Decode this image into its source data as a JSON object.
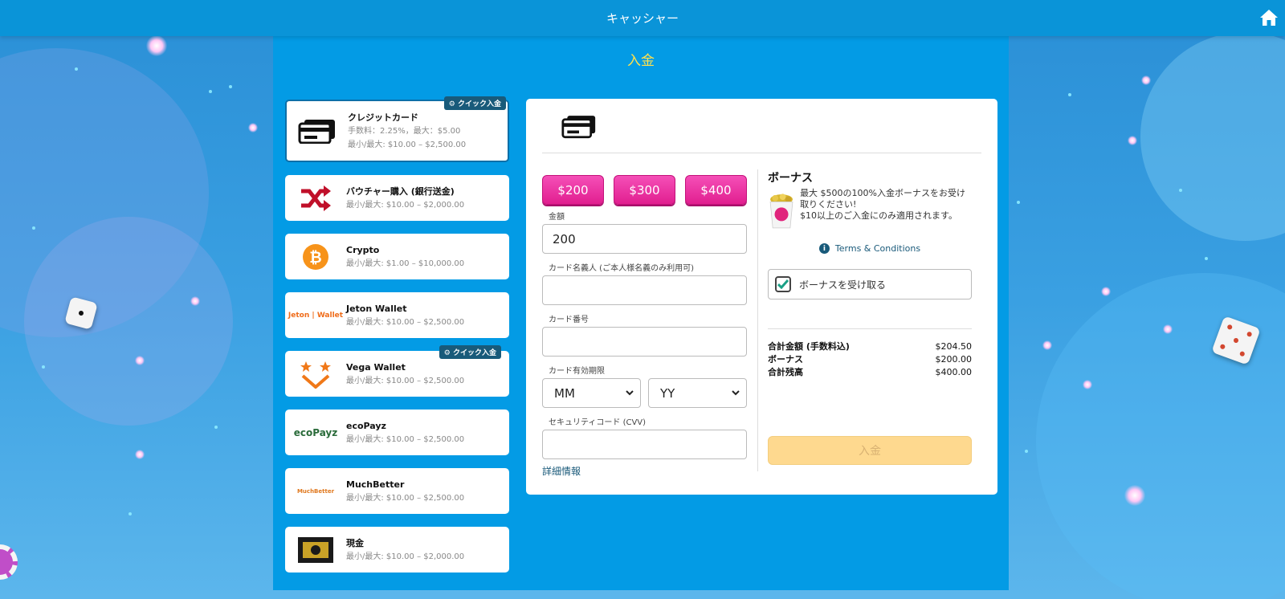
{
  "header": {
    "title": "キャッシャー"
  },
  "section_title": "入金",
  "colors": {
    "topbar": "#0a94d8",
    "panel": "#039be5",
    "section_title": "#ffe14d",
    "amount_button": "#e11f8f",
    "submit": "#fed98f",
    "badge": "#185a7a"
  },
  "quick_badge_label": "クイック入金",
  "methods": [
    {
      "icon": "credit-card-icon",
      "name": "クレジットカード",
      "line1": "手数料：2.25%，最大：$5.00",
      "line2": "最小/最大: $10.00 – $2,500.00",
      "quick": true
    },
    {
      "icon": "shuffle-icon",
      "name": "バウチャー購入 (銀行送金)",
      "line1": "最小/最大: $10.00 – $2,000.00",
      "quick": false
    },
    {
      "icon": "bitcoin-icon",
      "name": "Crypto",
      "line1": "最小/最大: $1.00 – $10,000.00",
      "quick": false
    },
    {
      "icon": "jeton-wallet-logo",
      "logo_text": "Jeton | Wallet",
      "name": "Jeton Wallet",
      "line1": "最小/最大: $10.00 – $2,500.00",
      "quick": false
    },
    {
      "icon": "vega-wallet-logo",
      "name": "Vega Wallet",
      "line1": "最小/最大: $10.00 – $2,500.00",
      "quick": true
    },
    {
      "icon": "ecopayz-logo",
      "logo_text": "ecoPayz",
      "name": "ecoPayz",
      "line1": "最小/最大: $10.00 – $2,500.00",
      "quick": false
    },
    {
      "icon": "muchbetter-logo",
      "logo_text": "MuchBetter",
      "name": "MuchBetter",
      "line1": "最小/最大: $10.00 – $2,500.00",
      "quick": false
    },
    {
      "icon": "cash-logo",
      "name": "現金",
      "line1": "最小/最大: $10.00 – $2,000.00",
      "quick": false
    }
  ],
  "form": {
    "amount_buttons": [
      "$200",
      "$300",
      "$400"
    ],
    "amount_label": "金額",
    "amount_value": "200",
    "cardholder_label": "カード名義人 (ご本人様名義のみ利用可)",
    "card_number_label": "カード番号",
    "expiry_label": "カード有効期限",
    "month_value": "MM",
    "year_value": "YY",
    "cvv_label": "セキュリティコード (CVV)",
    "details_link": "詳細情報"
  },
  "bonus": {
    "title": "ボーナス",
    "line1": "最大 $500の100%入金ボーナスをお受け取りください!",
    "line2": "$10以上のご入金にのみ適用されます。",
    "terms": "Terms & Conditions",
    "checkbox_label": "ボーナスを受け取る",
    "checked": true
  },
  "totals": {
    "total_label": "合計金額 (手数料込)",
    "total_value": "$204.50",
    "bonus_label": "ボーナス",
    "bonus_value": "$200.00",
    "balance_label": "合計残高",
    "balance_value": "$400.00"
  },
  "submit_label": "入金"
}
